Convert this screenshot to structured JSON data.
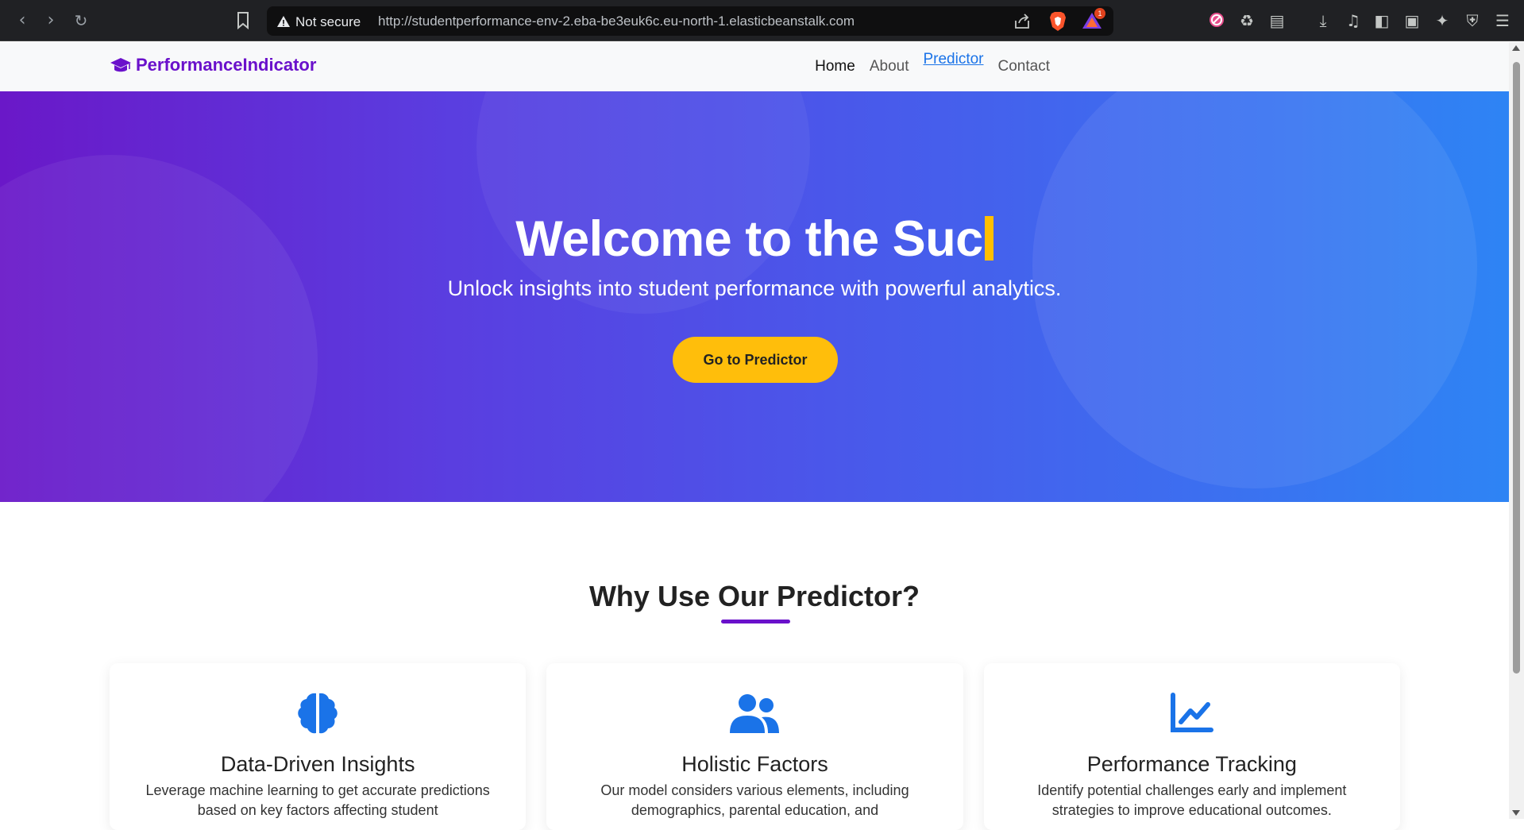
{
  "browser": {
    "security_label": "Not secure",
    "url": "http://studentperformance-env-2.eba-be3euk6c.eu-north-1.elasticbeanstalk.com",
    "rewards_badge": "1"
  },
  "site": {
    "brand": "PerformanceIndicator",
    "brand_color": "#6a11cb",
    "nav": {
      "home": "Home",
      "about": "About",
      "predictor": "Predictor",
      "contact": "Contact"
    }
  },
  "hero": {
    "title": "Welcome to the Suc",
    "subtitle": "Unlock insights into student performance with powerful analytics.",
    "cta": "Go to Predictor",
    "cta_color": "#ffbe0b"
  },
  "features": {
    "heading": "Why Use Our Predictor?",
    "items": [
      {
        "icon": "brain-icon",
        "title": "Data-Driven Insights",
        "text": "Leverage machine learning to get accurate predictions based on key factors affecting student"
      },
      {
        "icon": "users-icon",
        "title": "Holistic Factors",
        "text": "Our model considers various elements, including demographics, parental education, and"
      },
      {
        "icon": "chart-line-icon",
        "title": "Performance Tracking",
        "text": "Identify potential challenges early and implement strategies to improve educational outcomes."
      }
    ]
  },
  "icon_color": "#1a73e8"
}
